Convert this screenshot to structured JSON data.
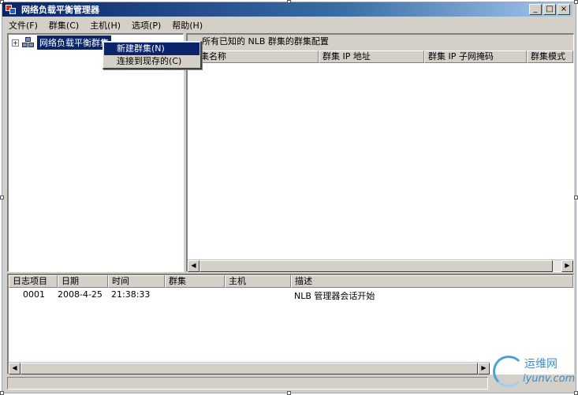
{
  "window": {
    "title": "网络负载平衡管理器"
  },
  "window_buttons": {
    "minimize": "_",
    "maximize": "□",
    "close": "×"
  },
  "menu": [
    {
      "label": "文件(F)"
    },
    {
      "label": "群集(C)"
    },
    {
      "label": "主机(H)"
    },
    {
      "label": "选项(P)"
    },
    {
      "label": "帮助(H)"
    }
  ],
  "tree": {
    "expander": "+",
    "root_label": "网络负载平衡群集"
  },
  "context_menu": [
    {
      "label": "新建群集(N)"
    },
    {
      "label": "连接到现存的(C)"
    }
  ],
  "cluster_panel": {
    "header": "所有已知的 NLB 群集的群集配置",
    "columns": [
      "群集名称",
      "群集 IP 地址",
      "群集 IP 子网掩码",
      "群集模式"
    ]
  },
  "scroll": {
    "left": "◀",
    "right": "▶"
  },
  "log_panel": {
    "columns": [
      "日志项目",
      "日期",
      "时间",
      "群集",
      "主机",
      "描述"
    ],
    "rows": [
      {
        "entry": "0001",
        "date": "2008-4-25",
        "time": "21:38:33",
        "cluster": "",
        "host": "",
        "description": "NLB 管理器会话开始"
      }
    ]
  },
  "watermark": {
    "cn": "运维网",
    "en": "iyunv.com"
  }
}
